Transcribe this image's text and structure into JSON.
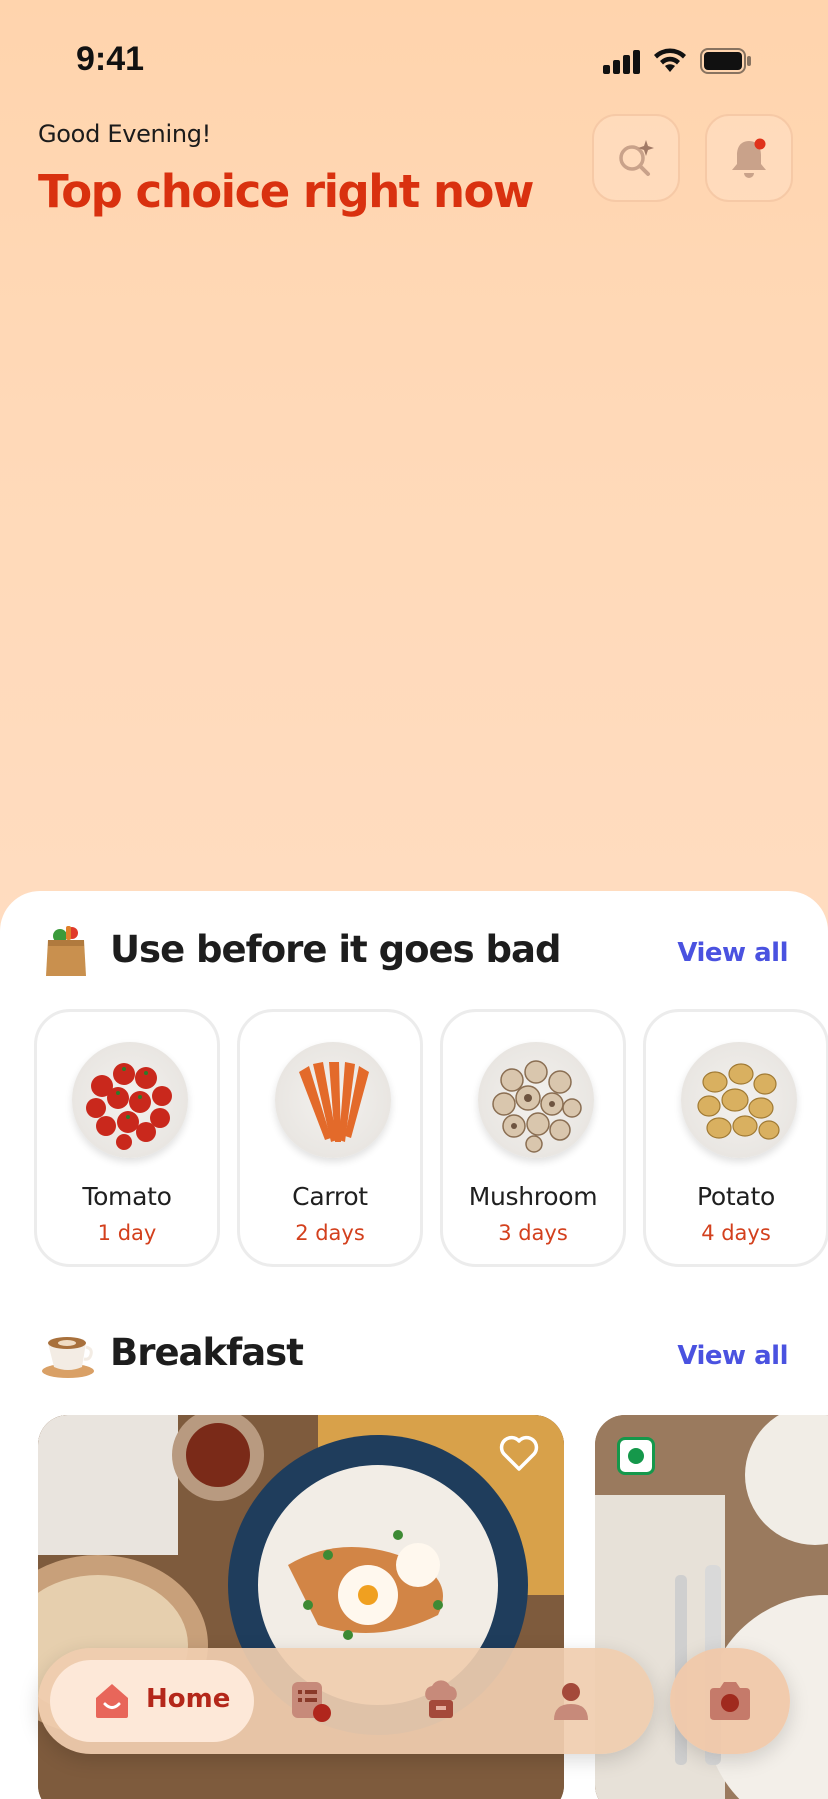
{
  "status_bar": {
    "time": "9:41"
  },
  "header": {
    "greeting": "Good Evening!",
    "headline": "Top choice right now"
  },
  "use_before": {
    "title": "Use before it goes bad",
    "view_all": "View all",
    "items": [
      {
        "name": "Tomato",
        "days": "1 day"
      },
      {
        "name": "Carrot",
        "days": "2 days"
      },
      {
        "name": "Mushroom",
        "days": "3 days"
      },
      {
        "name": "Potato",
        "days": "4 days"
      }
    ]
  },
  "breakfast": {
    "title": "Breakfast",
    "view_all": "View all"
  },
  "nav": {
    "home_label": "Home"
  },
  "colors": {
    "accent": "#d9310f",
    "link": "#4a52e0",
    "days": "#d3401d",
    "veg": "#15984b"
  }
}
